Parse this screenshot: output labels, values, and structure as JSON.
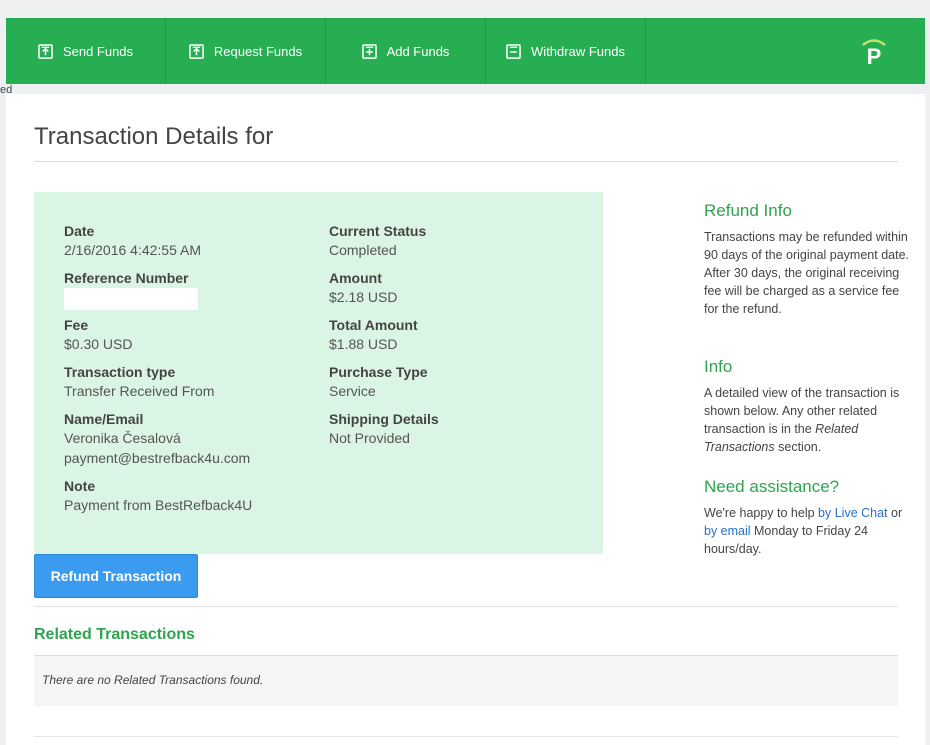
{
  "nav": {
    "items": [
      {
        "label": "Send Funds",
        "icon": "send-funds-icon"
      },
      {
        "label": "Request Funds",
        "icon": "request-funds-icon"
      },
      {
        "label": "Add Funds",
        "icon": "add-funds-icon"
      },
      {
        "label": "Withdraw Funds",
        "icon": "withdraw-funds-icon"
      }
    ],
    "logo_letter": "P",
    "colors": {
      "bar": "#27ae53",
      "logo_arc": "#c6e46a"
    }
  },
  "stray_text": "ed",
  "page": {
    "title": "Transaction Details for"
  },
  "details": {
    "date_label": "Date",
    "date_value": "2/16/2016 4:42:55 AM",
    "status_label": "Current Status",
    "status_value": "Completed",
    "reference_label": "Reference Number",
    "amount_label": "Amount",
    "amount_value": "$2.18 USD",
    "fee_label": "Fee",
    "fee_value": "$0.30 USD",
    "total_label": "Total Amount",
    "total_value": "$1.88 USD",
    "type_label": "Transaction type",
    "type_value": "Transfer Received From",
    "purchase_label": "Purchase Type",
    "purchase_value": "Service",
    "name_label": "Name/Email",
    "name_value": "Veronika Česalová",
    "email_value": "payment@bestrefback4u.com",
    "shipping_label": "Shipping Details",
    "shipping_value": "Not Provided",
    "note_label": "Note",
    "note_value": "Payment from BestRefback4U"
  },
  "refund_button": "Refund Transaction",
  "related": {
    "title": "Related Transactions",
    "empty_text": "There are no Related Transactions found."
  },
  "sidebar": {
    "refund_title": "Refund Info",
    "refund_text": "Transactions may be refunded within 90 days of the original payment date. After 30 days, the original receiving fee will be charged as a service fee for the refund.",
    "info_title": "Info",
    "info_text_1": "A detailed view of the transaction is shown below. Any other related transaction is in the ",
    "info_text_em": "Related Transactions",
    "info_text_2": " section.",
    "help_title": "Need assistance?",
    "help_text_1": "We're happy to help ",
    "help_link_chat": "by Live Chat",
    "help_text_2": " or ",
    "help_link_email": "by email",
    "help_text_3": " Monday to Friday 24 hours/day."
  }
}
